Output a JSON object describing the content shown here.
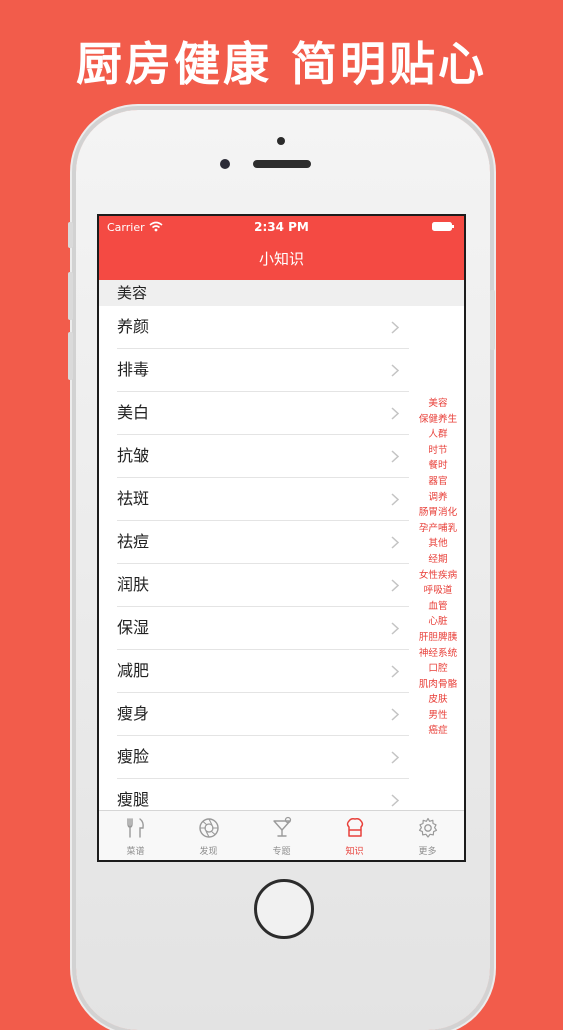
{
  "headline": "厨房健康 简明贴心",
  "status_bar": {
    "carrier": "Carrier",
    "time": "2:34 PM"
  },
  "nav": {
    "title": "小知识"
  },
  "section": {
    "title": "美容"
  },
  "list_items": [
    "养颜",
    "排毒",
    "美白",
    "抗皱",
    "祛斑",
    "祛痘",
    "润肤",
    "保湿",
    "减肥",
    "瘦身",
    "瘦脸",
    "瘦腿"
  ],
  "index_items": [
    "美容",
    "保健养生",
    "人群",
    "时节",
    "餐时",
    "器官",
    "调养",
    "肠胃消化",
    "孕产哺乳",
    "其他",
    "经期",
    "女性疾病",
    "呼吸道",
    "血管",
    "心脏",
    "肝胆脾胰",
    "神经系统",
    "口腔",
    "肌肉骨骼",
    "皮肤",
    "男性",
    "癌症"
  ],
  "tabs": [
    {
      "label": "菜谱",
      "icon": "fork-knife-icon",
      "active": false
    },
    {
      "label": "发现",
      "icon": "aperture-icon",
      "active": false
    },
    {
      "label": "专题",
      "icon": "cocktail-icon",
      "active": false
    },
    {
      "label": "知识",
      "icon": "chef-hat-icon",
      "active": true
    },
    {
      "label": "更多",
      "icon": "gear-icon",
      "active": false
    }
  ],
  "colors": {
    "background": "#f25c4b",
    "nav_bar": "#f44a43",
    "accent": "#e8403a"
  }
}
